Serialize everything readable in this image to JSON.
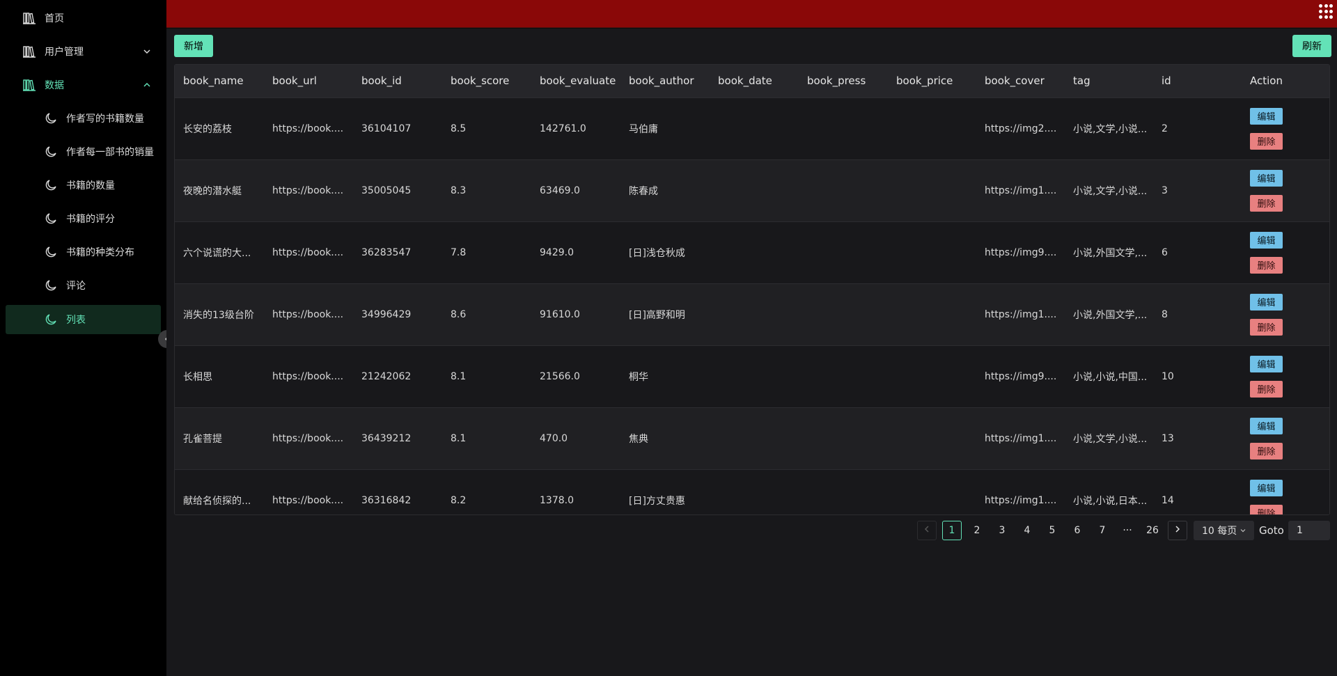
{
  "sidebar": {
    "items": [
      {
        "label": "首页",
        "icon": "library-icon"
      },
      {
        "label": "用户管理",
        "icon": "library-icon"
      },
      {
        "label": "数据",
        "icon": "library-icon"
      },
      {
        "label": "作者写的书籍数量",
        "icon": "moon-icon"
      },
      {
        "label": "作者每一部书的销量",
        "icon": "moon-icon"
      },
      {
        "label": "书籍的数量",
        "icon": "moon-icon"
      },
      {
        "label": "书籍的评分",
        "icon": "moon-icon"
      },
      {
        "label": "书籍的种类分布",
        "icon": "moon-icon"
      },
      {
        "label": "评论",
        "icon": "moon-icon"
      },
      {
        "label": "列表",
        "icon": "moon-icon"
      }
    ]
  },
  "toolbar": {
    "add_label": "新增",
    "refresh_label": "刷新"
  },
  "table": {
    "columns": [
      "book_name",
      "book_url",
      "book_id",
      "book_score",
      "book_evaluate",
      "book_author",
      "book_date",
      "book_press",
      "book_price",
      "book_cover",
      "tag",
      "id",
      "Action"
    ],
    "edit_label": "编辑",
    "delete_label": "删除",
    "rows": [
      [
        "长安的荔枝",
        "https://book....",
        "36104107",
        "8.5",
        "142761.0",
        "马伯庸",
        "",
        "",
        "",
        "https://img2....",
        "小说,文学,小说...",
        "2"
      ],
      [
        "夜晚的潜水艇",
        "https://book....",
        "35005045",
        "8.3",
        "63469.0",
        "陈春成",
        "",
        "",
        "",
        "https://img1....",
        "小说,文学,小说...",
        "3"
      ],
      [
        "六个说谎的大...",
        "https://book....",
        "36283547",
        "7.8",
        "9429.0",
        "[日]浅仓秋成",
        "",
        "",
        "",
        "https://img9....",
        "小说,外国文学,...",
        "6"
      ],
      [
        "消失的13级台阶",
        "https://book....",
        "34996429",
        "8.6",
        "91610.0",
        "[日]高野和明",
        "",
        "",
        "",
        "https://img1....",
        "小说,外国文学,...",
        "8"
      ],
      [
        "长相思",
        "https://book....",
        "21242062",
        "8.1",
        "21566.0",
        "桐华",
        "",
        "",
        "",
        "https://img9....",
        "小说,小说,中国...",
        "10"
      ],
      [
        "孔雀菩提",
        "https://book....",
        "36439212",
        "8.1",
        "470.0",
        "焦典",
        "",
        "",
        "",
        "https://img1....",
        "小说,文学,小说...",
        "13"
      ],
      [
        "献给名侦探的...",
        "https://book....",
        "36316842",
        "8.2",
        "1378.0",
        "[日]方丈贵惠",
        "",
        "",
        "",
        "https://img1....",
        "小说,小说,日本...",
        "14"
      ]
    ]
  },
  "pagination": {
    "pages": [
      "1",
      "2",
      "3",
      "4",
      "5",
      "6",
      "7",
      "···",
      "26"
    ],
    "current": "1",
    "page_size": "10 每页",
    "goto_label": "Goto",
    "goto_value": "1"
  },
  "colors": {
    "accent": "#63e2b7",
    "topbar": "#8a0808",
    "edit": "#70c0e8",
    "delete": "#e88080"
  }
}
